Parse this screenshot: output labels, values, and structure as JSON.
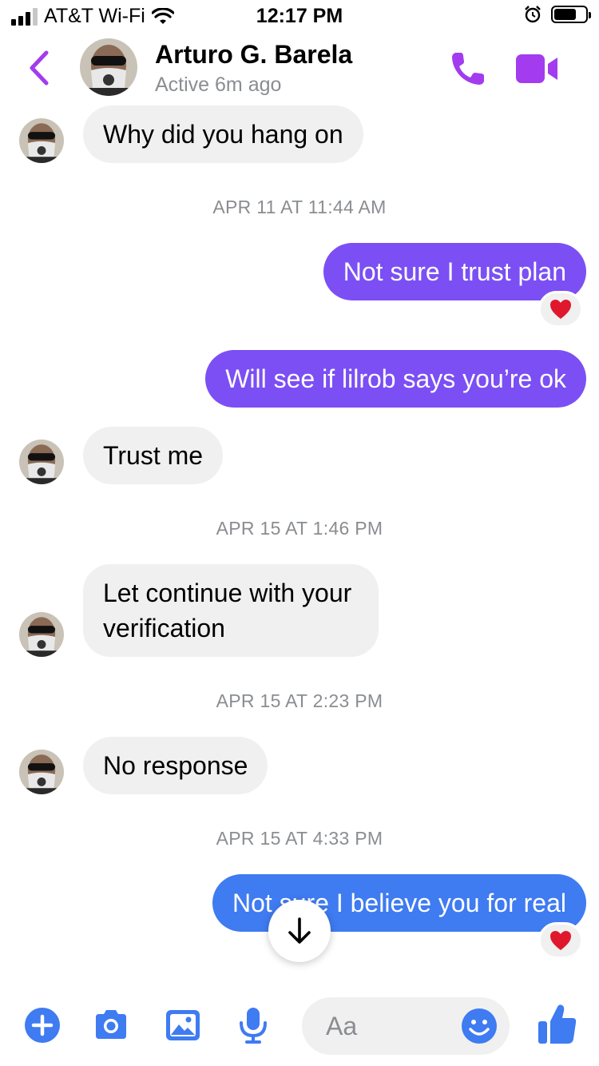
{
  "status_bar": {
    "carrier": "AT&T Wi-Fi",
    "time": "12:17 PM",
    "signal_icon": "cellular-signal-icon",
    "wifi_icon": "wifi-icon",
    "alarm_icon": "alarm-clock-icon",
    "battery_level": 0.72
  },
  "header": {
    "name": "Arturo G. Barela",
    "status": "Active 6m ago",
    "back_icon": "chevron-left-icon",
    "call_icon": "phone-icon",
    "video_icon": "video-camera-icon",
    "accent_color": "#a33bef"
  },
  "messages": [
    {
      "type": "in",
      "text": "Why did you hang on"
    },
    {
      "type": "timestamp",
      "text": "APR 11 AT 11:44 AM"
    },
    {
      "type": "out",
      "text": "Not sure I trust plan",
      "reaction": "❤️"
    },
    {
      "type": "out",
      "text": "Will see if lilrob says you’re ok"
    },
    {
      "type": "in",
      "text": "Trust me"
    },
    {
      "type": "timestamp",
      "text": "APR 15 AT 1:46 PM"
    },
    {
      "type": "in",
      "lines": [
        "Let continue with your",
        "verification"
      ]
    },
    {
      "type": "timestamp",
      "text": "APR 15 AT 2:23 PM"
    },
    {
      "type": "in",
      "text": "No response"
    },
    {
      "type": "timestamp",
      "text": "APR 15 AT 4:33 PM"
    },
    {
      "type": "out",
      "text": "Not sure I believe you for real",
      "reaction": "❤️"
    }
  ],
  "scroll_button": {
    "icon": "arrow-down-icon"
  },
  "composer": {
    "placeholder": "Aa",
    "icons": [
      "plus-icon",
      "camera-icon",
      "image-icon",
      "microphone-icon",
      "emoji-icon",
      "thumbs-up-icon"
    ],
    "icon_color": "#3f7bf1"
  },
  "colors": {
    "outgoing_purple": "#7b4ff4",
    "outgoing_blue": "#3f7bf1",
    "incoming_gray": "#f0f0f0"
  }
}
